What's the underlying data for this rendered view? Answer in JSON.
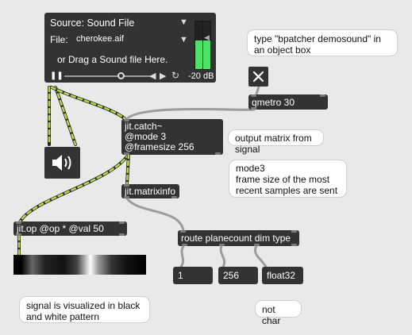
{
  "player": {
    "source_label": "Source: Sound File",
    "file_label": "File:",
    "file_value": "cherokee.aif",
    "drag_hint": "or Drag a Sound file Here.",
    "gain_readout": "-20 dB",
    "meter_levels": [
      0.6,
      0.6
    ],
    "position": 0.66
  },
  "toggle": {
    "state": "on"
  },
  "objects": {
    "qmetro": "qmetro 30",
    "jit_catch": "jit.catch~\n@mode 3\n@framesize 256",
    "matrixinfo": "jit.matrixinfo",
    "jit_op": "jit.op @op * @val 50",
    "route": "route planecount dim type"
  },
  "numbers": {
    "planecount": "1",
    "dim": "256",
    "type": "float32"
  },
  "comments": {
    "bpatcher": "type \"bpatcher demosound\" in an object box",
    "output": "output matrix from signal",
    "mode3": "mode3\nframe size of the most recent samples are sent",
    "notchar": "not char",
    "visualized": "signal is visualized in black and white pattern"
  },
  "colors": {
    "object_bg": "#333333",
    "canvas_bg": "#e9e9e9",
    "signal_cable": "#b6d94c",
    "meter_green": "#4fe06a"
  },
  "icons": {
    "speaker": "speaker-icon",
    "toggle": "close-x-icon"
  }
}
